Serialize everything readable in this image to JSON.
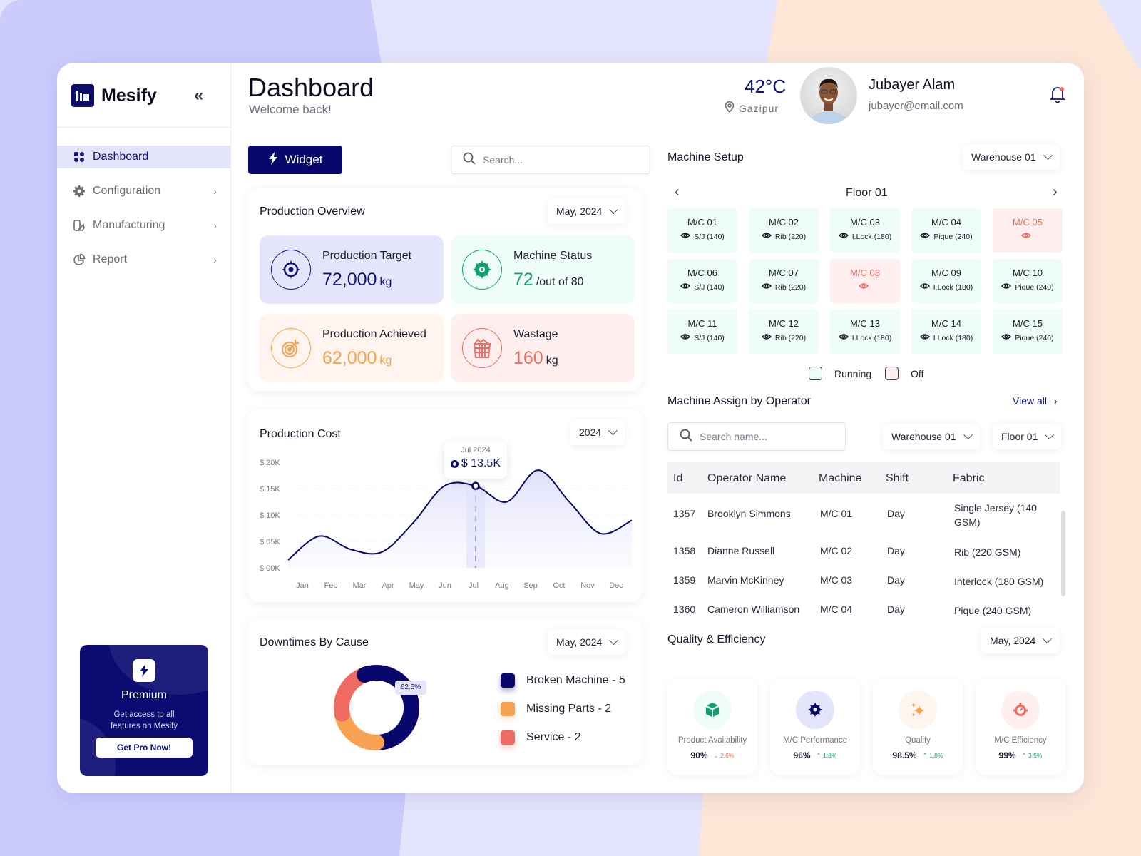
{
  "brand": {
    "name": "Mesify"
  },
  "sidebar": {
    "items": [
      {
        "label": "Dashboard",
        "icon": "grid-icon",
        "active": true
      },
      {
        "label": "Configuration",
        "icon": "gear-icon",
        "has_children": true
      },
      {
        "label": "Manufacturing",
        "icon": "manufacturing-icon",
        "has_children": true
      },
      {
        "label": "Report",
        "icon": "pie-chart-icon",
        "has_children": true
      }
    ],
    "premium": {
      "title": "Premium",
      "description_line1": "Get access to all",
      "description_line2": "features on Mesify",
      "button": "Get Pro Now!"
    }
  },
  "header": {
    "title": "Dashboard",
    "subtitle": "Welcome back!",
    "weather": {
      "temp": "42",
      "unit": "°C",
      "location": "Gazipur"
    },
    "user": {
      "name": "Jubayer Alam",
      "email": "jubayer@email.com"
    }
  },
  "toolbar": {
    "widget_label": "Widget",
    "search_placeholder": "Search..."
  },
  "production_overview": {
    "title": "Production Overview",
    "period": "May, 2024",
    "stats": [
      {
        "label": "Production Target",
        "value": "72,000",
        "unit": "kg",
        "color": "#13137a",
        "bg": "#e4e4fb"
      },
      {
        "label": "Machine Status",
        "value": "72",
        "unit": "/out of 80",
        "color": "#12a070",
        "bg": "#effdf8"
      },
      {
        "label": "Production Achieved",
        "value": "62,000",
        "unit": "kg",
        "color": "#f7a250",
        "bg": "#fff5ee"
      },
      {
        "label": "Wastage",
        "value": "160",
        "unit": "kg",
        "color": "#ef6b61",
        "bg": "#fff0ef"
      }
    ]
  },
  "production_cost": {
    "title": "Production Cost",
    "period": "2024",
    "tooltip": {
      "label": "Jul 2024",
      "value": "$ 13.5K"
    }
  },
  "chart_data": {
    "type": "area",
    "title": "Production Cost",
    "xlabel": "",
    "ylabel": "",
    "categories": [
      "Jan",
      "Feb",
      "Mar",
      "Apr",
      "May",
      "Jun",
      "Jul",
      "Aug",
      "Sep",
      "Oct",
      "Nov",
      "Dec"
    ],
    "series": [
      {
        "name": "Production Cost ($K)",
        "values": [
          1.5,
          6,
          3.5,
          3,
          8.5,
          15.5,
          15.5,
          12.5,
          18.5,
          12.5,
          6.5,
          9
        ]
      }
    ],
    "ylim": [
      0,
      20
    ],
    "yticks": [
      "$ 00K",
      "$ 05K",
      "$ 10K",
      "$ 15K",
      "$ 20K"
    ],
    "highlight": {
      "category": "Jul",
      "label": "Jul 2024",
      "value": "$ 13.5K"
    },
    "grid": true
  },
  "downtimes": {
    "title": "Downtimes By Cause",
    "period": "May, 2024",
    "donut_label": "62.5%",
    "items": [
      {
        "label": "Broken Machine - 5",
        "value": 5,
        "color": "#07076c"
      },
      {
        "label": "Missing Parts - 2",
        "value": 2,
        "color": "#f7a250"
      },
      {
        "label": "Service - 2",
        "value": 2,
        "color": "#ef6b61"
      }
    ]
  },
  "machine_setup": {
    "title": "Machine Setup",
    "warehouse": "Warehouse 01",
    "floor": "Floor 01",
    "machines": [
      {
        "name": "M/C 01",
        "fabric": "S/J (140)",
        "status": "running"
      },
      {
        "name": "M/C 02",
        "fabric": "Rib (220)",
        "status": "running"
      },
      {
        "name": "M/C 03",
        "fabric": "I.Lock (180)",
        "status": "running"
      },
      {
        "name": "M/C 04",
        "fabric": "Pique (240)",
        "status": "running"
      },
      {
        "name": "M/C 05",
        "fabric": "",
        "status": "off"
      },
      {
        "name": "M/C 06",
        "fabric": "S/J (140)",
        "status": "running"
      },
      {
        "name": "M/C 07",
        "fabric": "Rib (220)",
        "status": "running"
      },
      {
        "name": "M/C 08",
        "fabric": "",
        "status": "off"
      },
      {
        "name": "M/C 09",
        "fabric": "I.Lock (180)",
        "status": "running"
      },
      {
        "name": "M/C 10",
        "fabric": "Pique (240)",
        "status": "running"
      },
      {
        "name": "M/C 11",
        "fabric": "S/J (140)",
        "status": "running"
      },
      {
        "name": "M/C 12",
        "fabric": "Rib (220)",
        "status": "running"
      },
      {
        "name": "M/C 13",
        "fabric": "I.Lock (180)",
        "status": "running"
      },
      {
        "name": "M/C 14",
        "fabric": "I.Lock (180)",
        "status": "running"
      },
      {
        "name": "M/C 15",
        "fabric": "Pique (240)",
        "status": "running"
      }
    ],
    "legend": {
      "running": "Running",
      "off": "Off"
    }
  },
  "machine_assign": {
    "title": "Machine Assign by Operator",
    "view_all": "View all",
    "search_placeholder": "Search name...",
    "warehouse": "Warehouse 01",
    "floor": "Floor 01",
    "columns": [
      "Id",
      "Operator Name",
      "Machine",
      "Shift",
      "Fabric"
    ],
    "rows": [
      {
        "id": "1357",
        "name": "Brooklyn Simmons",
        "machine": "M/C 01",
        "shift": "Day",
        "fabric_line1": "Single Jersey (140",
        "fabric_line2": "GSM)"
      },
      {
        "id": "1358",
        "name": "Dianne Russell",
        "machine": "M/C 02",
        "shift": "Day",
        "fabric_line1": "Rib (220 GSM)",
        "fabric_line2": ""
      },
      {
        "id": "1359",
        "name": "Marvin McKinney",
        "machine": "M/C 03",
        "shift": "Day",
        "fabric_line1": "Interlock (180 GSM)",
        "fabric_line2": ""
      },
      {
        "id": "1360",
        "name": "Cameron Williamson",
        "machine": "M/C 04",
        "shift": "Day",
        "fabric_line1": "Pique (240 GSM)",
        "fabric_line2": ""
      }
    ]
  },
  "quality": {
    "title": "Quality & Efficiency",
    "period": "May, 2024",
    "cards": [
      {
        "label": "Product Availability",
        "value": "90%",
        "delta": "2.6%",
        "direction": "down",
        "icon": "cube-icon"
      },
      {
        "label": "M/C Performance",
        "value": "96%",
        "delta": "1.8%",
        "direction": "up",
        "icon": "gear-icon"
      },
      {
        "label": "Quality",
        "value": "98.5%",
        "delta": "1.8%",
        "direction": "up",
        "icon": "sparkle-icon"
      },
      {
        "label": "M/C Efficiency",
        "value": "99%",
        "delta": "3.5%",
        "direction": "up",
        "icon": "speedometer-icon"
      }
    ]
  }
}
